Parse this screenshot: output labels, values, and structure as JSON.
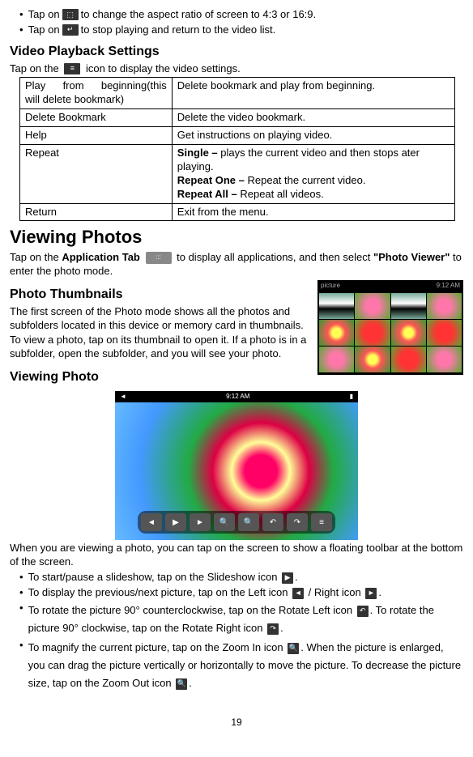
{
  "top_bullets": [
    {
      "pre": "Tap on",
      "icon": "aspect-ratio-icon",
      "post": " to change the aspect ratio of screen to 4:3 or 16:9."
    },
    {
      "pre": "Tap on",
      "icon": "return-icon",
      "post": " to stop playing and return to the video list."
    }
  ],
  "video_settings": {
    "heading": "Video Playback Settings",
    "intro_pre": "Tap on the ",
    "intro_post": " icon to display the video settings.",
    "rows": [
      {
        "l": "Play from beginning(this will delete bookmark)",
        "r": "Delete bookmark and play from beginning."
      },
      {
        "l": "Delete Bookmark",
        "r": "Delete the video bookmark."
      },
      {
        "l": "Help",
        "r": "Get instructions on playing video."
      },
      {
        "l": "Repeat",
        "r_single_b": "Single –",
        "r_single": " plays the current video and then stops ater playing.",
        "r_one_b": "Repeat One –",
        "r_one": " Repeat the current video.",
        "r_all_b": "Repeat All –",
        "r_all": " Repeat all videos."
      },
      {
        "l": "Return",
        "r": "Exit from the menu."
      }
    ]
  },
  "viewing_photos": {
    "heading": "Viewing Photos",
    "p1_pre": "Tap on the ",
    "p1_b": "Application Tab",
    "p1_mid": " ",
    "p1_post": " to display all applications, and then select ",
    "p1_b2": "\"Photo Viewer\"",
    "p1_end": " to enter the photo mode."
  },
  "thumbs": {
    "heading": "Photo Thumbnails",
    "p1": "The first screen of the Photo mode shows all the photos and subfolders located in this device or memory card in thumbnails.",
    "p2": "To view a photo, tap on its thumbnail to open it. If a photo is in a subfolder, open the subfolder, and you will see your photo.",
    "header_left": "picture",
    "header_right": "9:12 AM"
  },
  "viewing_photo": {
    "heading": "Viewing Photo",
    "time": "9:12 AM",
    "after_p_pre": "When you are viewing a photo, you can tap on the screen to show a floating toolbar at the bottom of the screen.",
    "bullets": {
      "b1_pre": "To start/pause a slideshow, tap on the Slideshow icon ",
      "b1_post": ".",
      "b2_pre": "To display the previous/next picture, tap on the Left icon ",
      "b2_mid": " / Right icon ",
      "b2_post": ".",
      "b3_pre": "To rotate the picture 90° counterclockwise, tap on the Rotate Left icon ",
      "b3_mid": ". To rotate the picture 90° clockwise, tap on the Rotate Right icon ",
      "b3_post": ".",
      "b4_pre": "To magnify the current picture, tap on the Zoom In icon ",
      "b4_mid": ". When the picture is enlarged, you can drag the picture vertically or horizontally to move the picture. To decrease the picture size, tap on the Zoom Out icon ",
      "b4_post": "."
    }
  },
  "page": "19"
}
